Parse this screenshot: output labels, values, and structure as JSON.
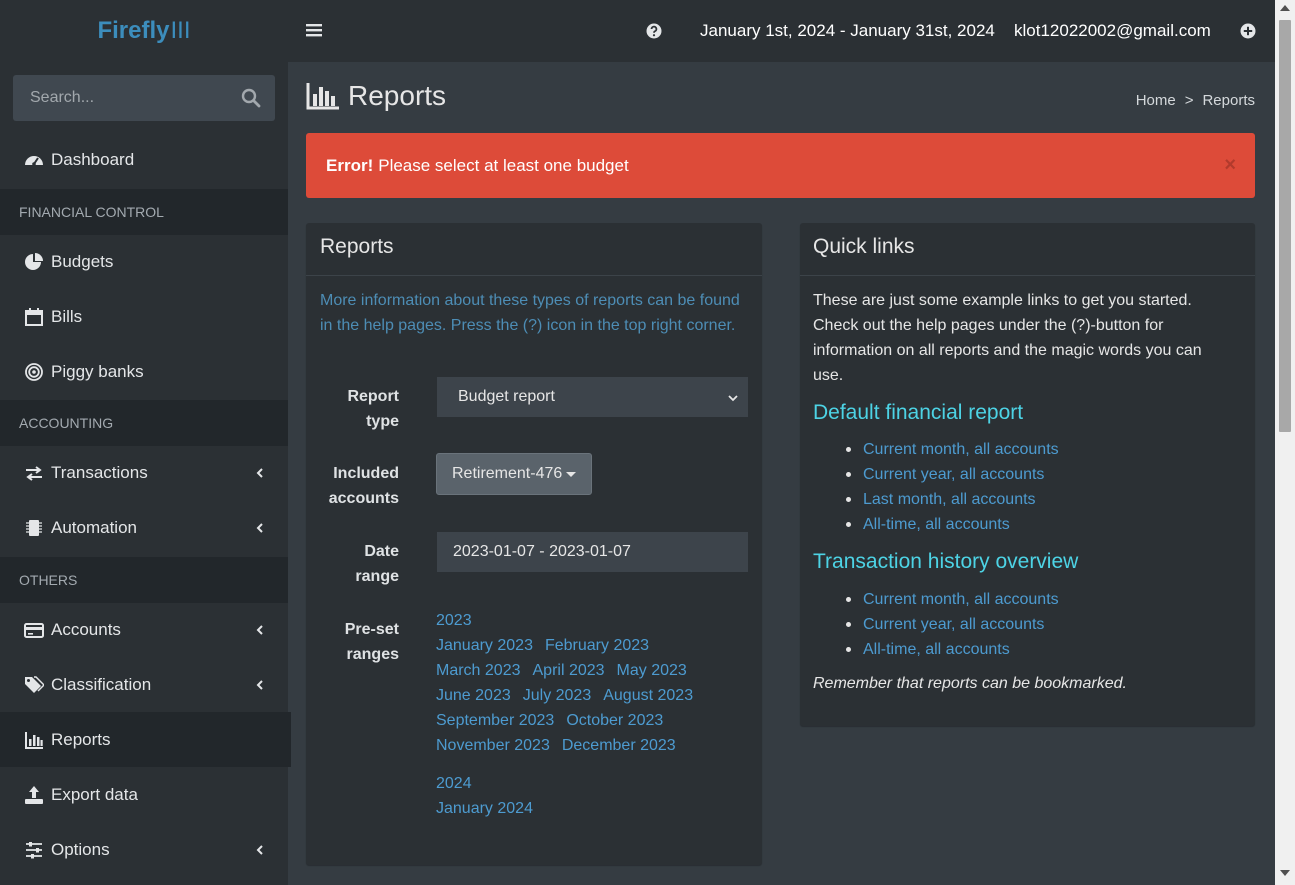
{
  "app": {
    "logo_main": "Firefly",
    "logo_lite": "III"
  },
  "header": {
    "date_range": "January 1st, 2024 - January 31st, 2024",
    "user_email": "klot12022002@gmail.com",
    "icons": [
      "bars-icon",
      "question-circle-icon",
      "plus-circle-icon"
    ]
  },
  "sidebar": {
    "search_placeholder": "Search...",
    "items": [
      {
        "label": "Dashboard",
        "icon": "tachometer-icon"
      },
      {
        "header": "FINANCIAL CONTROL"
      },
      {
        "label": "Budgets",
        "icon": "pie-chart-icon"
      },
      {
        "label": "Bills",
        "icon": "calendar-icon"
      },
      {
        "label": "Piggy banks",
        "icon": "bullseye-icon"
      },
      {
        "header": "ACCOUNTING"
      },
      {
        "label": "Transactions",
        "icon": "exchange-icon"
      },
      {
        "label": "Automation",
        "icon": "microchip-icon"
      },
      {
        "header": "OTHERS"
      },
      {
        "label": "Accounts",
        "icon": "credit-card-icon"
      },
      {
        "label": "Classification",
        "icon": "tags-icon"
      },
      {
        "label": "Reports",
        "icon": "bar-chart-icon",
        "active": true
      },
      {
        "label": "Export data",
        "icon": "upload-icon"
      },
      {
        "label": "Options",
        "icon": "sliders-icon"
      }
    ]
  },
  "page": {
    "title": "Reports",
    "breadcrumb": [
      "Home",
      "Reports"
    ]
  },
  "alert": {
    "strong": "Error!",
    "message": "Please select at least one budget",
    "close": "×",
    "color": "#dd4b39"
  },
  "reports_box": {
    "title": "Reports",
    "info": "More information about these types of reports can be found in the help pages. Press the (?) icon in the top right corner.",
    "report_type_label_1": "Report",
    "report_type_label_2": "type",
    "report_type_value": "Budget report",
    "included_accounts_label_1": "Included",
    "included_accounts_label_2": "accounts",
    "included_accounts_value": "Retirement-476",
    "date_range_label_1": "Date",
    "date_range_label_2": "range",
    "date_range_value": "2023-01-07 - 2023-01-07",
    "preset_label_1": "Pre-set",
    "preset_label_2": "ranges",
    "preset_years": [
      {
        "year": "2023",
        "rows": [
          [
            "January 2023",
            "February 2023"
          ],
          [
            "March 2023",
            "April 2023",
            "May 2023"
          ],
          [
            "June 2023",
            "July 2023",
            "August 2023"
          ],
          [
            "September 2023",
            "October 2023"
          ],
          [
            "November 2023",
            "December 2023"
          ]
        ]
      },
      {
        "year": "2024",
        "rows": [
          [
            "January 2024"
          ]
        ]
      }
    ]
  },
  "quick_links": {
    "title": "Quick links",
    "intro": "These are just some example links to get you started. Check out the help pages under the (?)-button for information on all reports and the magic words you can use.",
    "sections": [
      {
        "heading": "Default financial report",
        "links": [
          "Current month, all accounts",
          "Current year, all accounts",
          "Last month, all accounts",
          "All-time, all accounts"
        ]
      },
      {
        "heading": "Transaction history overview",
        "links": [
          "Current month, all accounts",
          "Current year, all accounts",
          "All-time, all accounts"
        ]
      }
    ],
    "footer": "Remember that reports can be bookmarked."
  },
  "colors": {
    "sidebar_bg": "#2b3034",
    "content_bg": "#353c42",
    "link": "#4d9bd0",
    "heading_link": "#4dd3e5",
    "logo": "#3c8dbc"
  }
}
